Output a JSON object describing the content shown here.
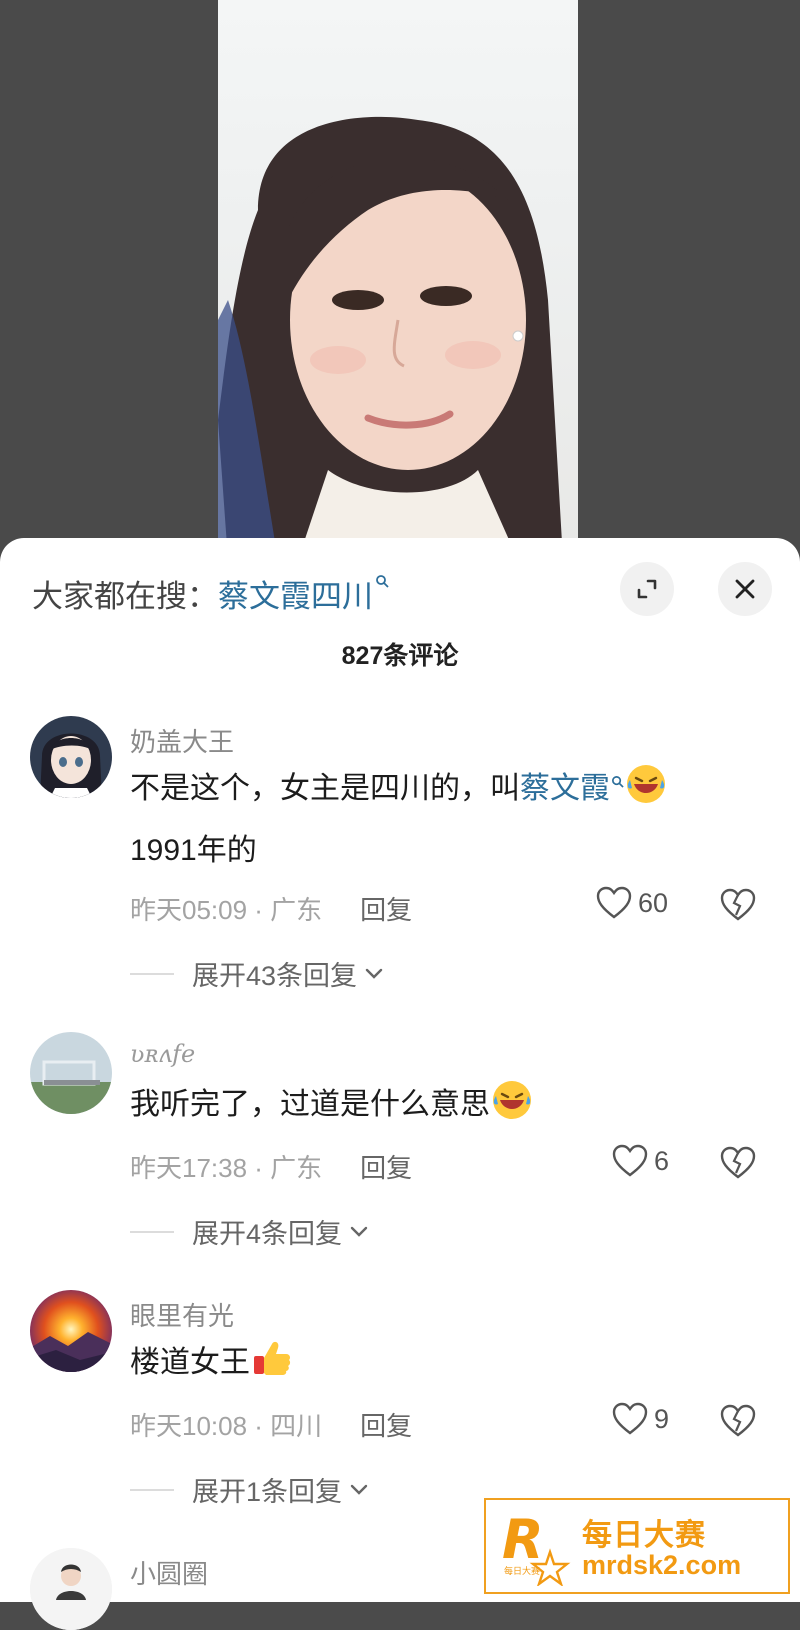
{
  "search": {
    "prefix": "大家都在搜：",
    "term": "蔡文霞四川",
    "search_icon": "search-icon"
  },
  "header": {
    "comment_count": "827条评论",
    "expand_icon": "expand-icon",
    "close_icon": "close-icon"
  },
  "comments": [
    {
      "username": "奶盖大王",
      "text_before": "不是这个，女主是四川的，叫",
      "link": "蔡文霞",
      "text_after": "1991年的",
      "emoji": "rofl-emoji",
      "time_location": "昨天05:09 · 广东",
      "reply": "回复",
      "likes": "60",
      "expand": "展开43条回复"
    },
    {
      "username": "ʋʀʌfe",
      "text": "我听完了，过道是什么意思",
      "emoji": "rofl-emoji",
      "time_location": "昨天17:38 · 广东",
      "reply": "回复",
      "likes": "6",
      "expand": "展开4条回复"
    },
    {
      "username": "眼里有光",
      "text": "楼道女王",
      "emoji": "thumbs-up-emoji",
      "time_location": "昨天10:08 · 四川",
      "reply": "回复",
      "likes": "9",
      "expand": "展开1条回复"
    },
    {
      "username": "小圆圈"
    }
  ],
  "watermark": {
    "letter": "R",
    "small_text": "每日大赛",
    "cn": "每日大赛",
    "url": "mrdsk2.com"
  },
  "colors": {
    "link": "#2c6e9a",
    "watermark": "#f29a12"
  }
}
